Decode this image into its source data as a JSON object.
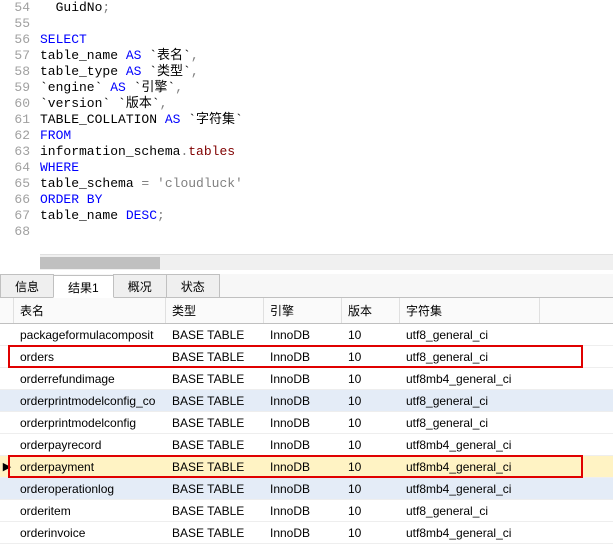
{
  "code": {
    "lines": [
      {
        "n": 54,
        "tokens": [
          {
            "t": "  GuidNo",
            "c": "plain"
          },
          {
            "t": ";",
            "c": "op"
          }
        ]
      },
      {
        "n": 55,
        "tokens": []
      },
      {
        "n": 56,
        "tokens": [
          {
            "t": "SELECT",
            "c": "kw"
          }
        ]
      },
      {
        "n": 57,
        "tokens": [
          {
            "t": "table_name ",
            "c": "plain"
          },
          {
            "t": "AS",
            "c": "kw"
          },
          {
            "t": " `表名`",
            "c": "plain"
          },
          {
            "t": ",",
            "c": "op"
          }
        ]
      },
      {
        "n": 58,
        "tokens": [
          {
            "t": "table_type ",
            "c": "plain"
          },
          {
            "t": "AS",
            "c": "kw"
          },
          {
            "t": " `类型`",
            "c": "plain"
          },
          {
            "t": ",",
            "c": "op"
          }
        ]
      },
      {
        "n": 59,
        "tokens": [
          {
            "t": "`engine` ",
            "c": "plain"
          },
          {
            "t": "AS",
            "c": "kw"
          },
          {
            "t": " `引擎`",
            "c": "plain"
          },
          {
            "t": ",",
            "c": "op"
          }
        ]
      },
      {
        "n": 60,
        "tokens": [
          {
            "t": "`version` `版本`",
            "c": "plain"
          },
          {
            "t": ",",
            "c": "op"
          }
        ]
      },
      {
        "n": 61,
        "tokens": [
          {
            "t": "TABLE_COLLATION ",
            "c": "plain"
          },
          {
            "t": "AS",
            "c": "kw"
          },
          {
            "t": " `字符集`",
            "c": "plain"
          }
        ]
      },
      {
        "n": 62,
        "tokens": [
          {
            "t": "FROM",
            "c": "kw"
          }
        ]
      },
      {
        "n": 63,
        "tokens": [
          {
            "t": "information_schema",
            "c": "plain"
          },
          {
            "t": ".",
            "c": "op"
          },
          {
            "t": "tables",
            "c": "ident"
          }
        ]
      },
      {
        "n": 64,
        "tokens": [
          {
            "t": "WHERE",
            "c": "kw"
          }
        ]
      },
      {
        "n": 65,
        "tokens": [
          {
            "t": "table_schema ",
            "c": "plain"
          },
          {
            "t": "=",
            "c": "op"
          },
          {
            "t": " ",
            "c": "plain"
          },
          {
            "t": "'cloudluck'",
            "c": "str"
          }
        ]
      },
      {
        "n": 66,
        "tokens": [
          {
            "t": "ORDER BY",
            "c": "kw"
          }
        ]
      },
      {
        "n": 67,
        "tokens": [
          {
            "t": "table_name ",
            "c": "plain"
          },
          {
            "t": "DESC",
            "c": "kw"
          },
          {
            "t": ";",
            "c": "op"
          }
        ]
      },
      {
        "n": 68,
        "tokens": []
      }
    ]
  },
  "tabs": [
    {
      "label": "信息",
      "active": false
    },
    {
      "label": "结果1",
      "active": true
    },
    {
      "label": "概况",
      "active": false
    },
    {
      "label": "状态",
      "active": false
    }
  ],
  "grid": {
    "columns": [
      "表名",
      "类型",
      "引擎",
      "版本",
      "字符集"
    ],
    "rows": [
      {
        "cells": [
          "packageformulacomposit",
          "BASE TABLE",
          "InnoDB",
          "10",
          "utf8_general_ci"
        ],
        "flags": []
      },
      {
        "cells": [
          "orders",
          "BASE TABLE",
          "InnoDB",
          "10",
          "utf8_general_ci"
        ],
        "flags": [
          "redbox"
        ]
      },
      {
        "cells": [
          "orderrefundimage",
          "BASE TABLE",
          "InnoDB",
          "10",
          "utf8mb4_general_ci"
        ],
        "flags": []
      },
      {
        "cells": [
          "orderprintmodelconfig_co",
          "BASE TABLE",
          "InnoDB",
          "10",
          "utf8_general_ci"
        ],
        "flags": [
          "hl-blue"
        ]
      },
      {
        "cells": [
          "orderprintmodelconfig",
          "BASE TABLE",
          "InnoDB",
          "10",
          "utf8_general_ci"
        ],
        "flags": []
      },
      {
        "cells": [
          "orderpayrecord",
          "BASE TABLE",
          "InnoDB",
          "10",
          "utf8mb4_general_ci"
        ],
        "flags": []
      },
      {
        "cells": [
          "orderpayment",
          "BASE TABLE",
          "InnoDB",
          "10",
          "utf8mb4_general_ci"
        ],
        "flags": [
          "hl-orange",
          "redbox",
          "current"
        ]
      },
      {
        "cells": [
          "orderoperationlog",
          "BASE TABLE",
          "InnoDB",
          "10",
          "utf8mb4_general_ci"
        ],
        "flags": [
          "hl-blue"
        ]
      },
      {
        "cells": [
          "orderitem",
          "BASE TABLE",
          "InnoDB",
          "10",
          "utf8_general_ci"
        ],
        "flags": []
      },
      {
        "cells": [
          "orderinvoice",
          "BASE TABLE",
          "InnoDB",
          "10",
          "utf8mb4_general_ci"
        ],
        "flags": []
      }
    ]
  }
}
